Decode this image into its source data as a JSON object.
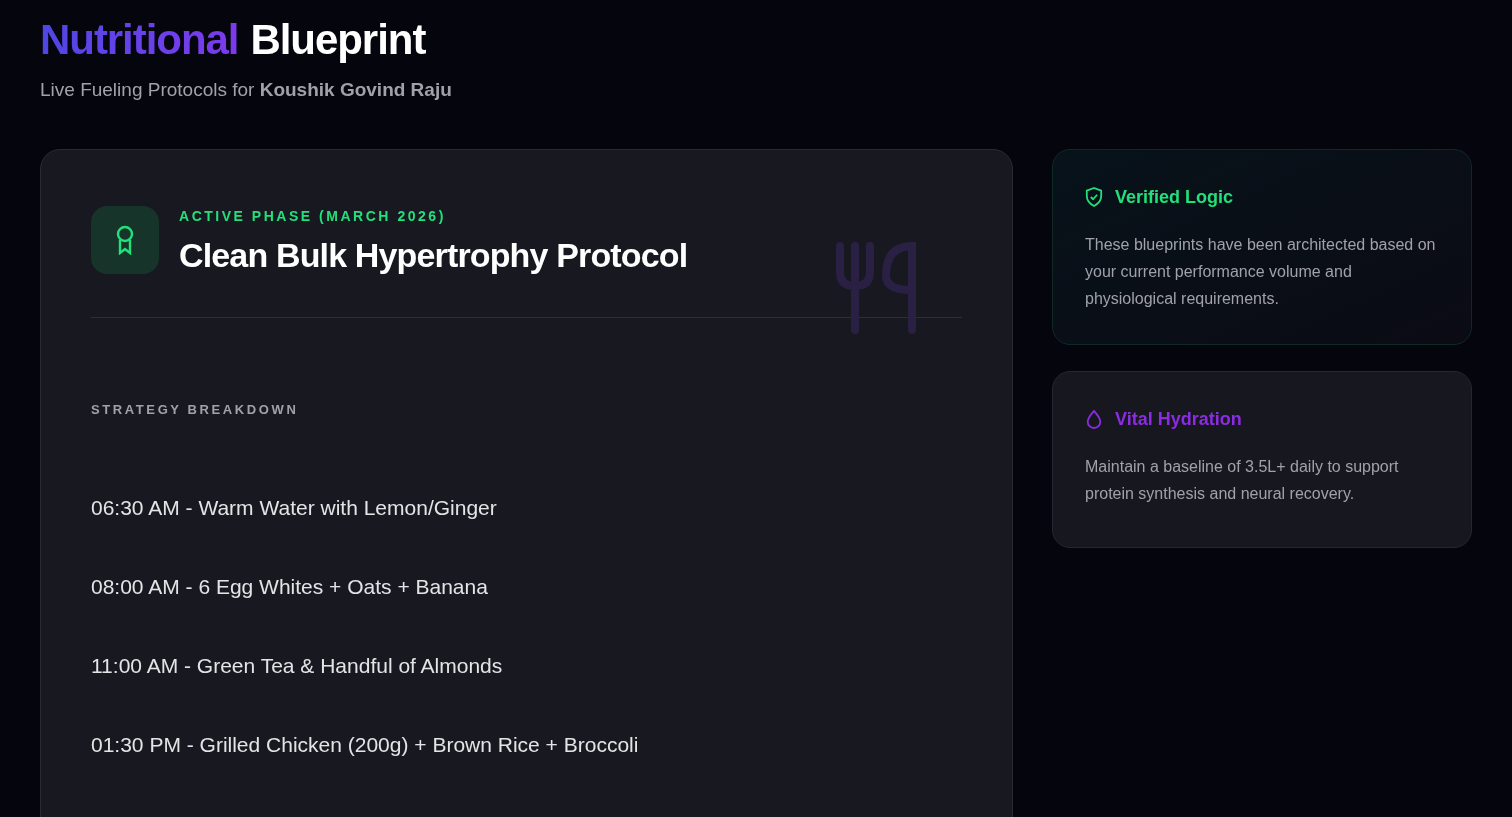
{
  "header": {
    "title_accent": "Nutritional",
    "title": "Blueprint",
    "subtitle": "Live Fueling Protocols for **Koushik Govind Raju**"
  },
  "protocol": {
    "eyebrow": "ACTIVE PHASE (MARCH 2026)",
    "title": "Clean Bulk Hypertrophy Protocol",
    "section_label": "STRATEGY BREAKDOWN",
    "items": [
      "06:30 AM - Warm Water with Lemon/Ginger",
      "08:00 AM - 6 Egg Whites + Oats + Banana",
      "11:00 AM - Green Tea & Handful of Almonds",
      "01:30 PM - Grilled Chicken (200g) + Brown Rice + Broccoli"
    ]
  },
  "info_cards": [
    {
      "kind": "verified",
      "color": "#22e07a",
      "title": "Verified Logic",
      "text": "These blueprints have been architected based on your current performance volume and physiological requirements."
    },
    {
      "kind": "hydration",
      "color": "#8b2be2",
      "title": "Vital Hydration",
      "text": "Maintain a baseline of 3.5L+ daily to support protein synthesis and neural recovery."
    }
  ]
}
